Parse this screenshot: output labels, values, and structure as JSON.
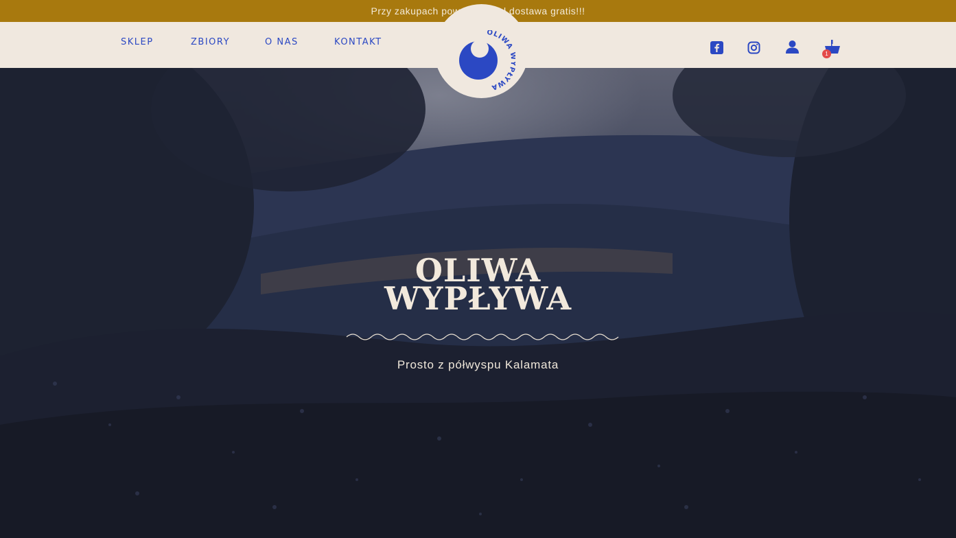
{
  "promo": {
    "text": "Przy zakupach powyżej 350zł dostawa gratis!!!"
  },
  "nav": {
    "links": [
      "SKLEP",
      "ZBIORY",
      "O NAS",
      "KONTAKT"
    ],
    "logo_text_top": "OLIWA",
    "logo_text_bottom": "WYPŁYWA",
    "icons": [
      "facebook-icon",
      "instagram-icon",
      "user-icon",
      "basket-icon"
    ],
    "cart_count": "1"
  },
  "hero": {
    "title_line1": "OLIWA",
    "title_line2": "WYPŁYWA",
    "subtitle": "Prosto z półwyspu Kalamata"
  },
  "colors": {
    "promo_bg": "#a8790e",
    "nav_bg": "#f0e8df",
    "accent_blue": "#2b48c3",
    "badge_red": "#e34a4a"
  }
}
